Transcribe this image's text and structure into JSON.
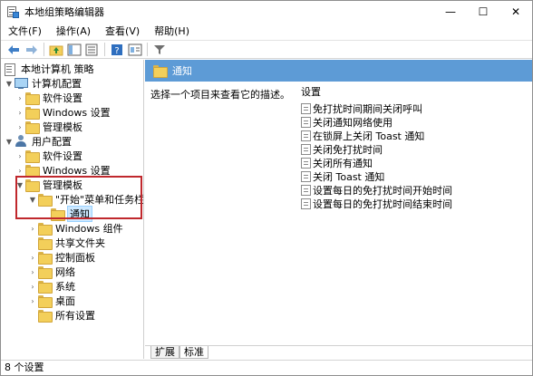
{
  "window": {
    "title": "本地组策略编辑器",
    "minimize": "—",
    "maximize": "☐",
    "close": "✕"
  },
  "menu": [
    "文件(F)",
    "操作(A)",
    "查看(V)",
    "帮助(H)"
  ],
  "toolbar": [
    "back-arrow-icon",
    "forward-arrow-icon",
    "up-folder-icon",
    "show-hide-tree-icon",
    "export-list-icon",
    "help-icon",
    "properties-icon",
    "filter-icon"
  ],
  "tree": {
    "root": "本地计算机 策略",
    "computer_config": "计算机配置",
    "computer_children": [
      "软件设置",
      "Windows 设置",
      "管理模板"
    ],
    "user_config": "用户配置",
    "user_children": [
      "软件设置",
      "Windows 设置",
      "管理模板"
    ],
    "admin_children": [
      "\"开始\"菜单和任务栏"
    ],
    "start_children": [
      "通知"
    ],
    "admin_other": [
      "Windows 组件",
      "共享文件夹",
      "控制面板",
      "网络",
      "系统",
      "桌面",
      "所有设置"
    ]
  },
  "right": {
    "header": "通知",
    "description": "选择一个项目来查看它的描述。",
    "settings_header": "设置",
    "settings": [
      "免打扰时间期间关闭呼叫",
      "关闭通知网络使用",
      "在锁屏上关闭 Toast 通知",
      "关闭免打扰时间",
      "关闭所有通知",
      "关闭 Toast 通知",
      "设置每日的免打扰时间开始时间",
      "设置每日的免打扰时间结束时间"
    ],
    "tabs": [
      "扩展",
      "标准"
    ]
  },
  "status": "8 个设置",
  "colors": {
    "header_blue": "#5d9bd6",
    "highlight_red": "#c0282d",
    "selection": "#cce8ff"
  }
}
